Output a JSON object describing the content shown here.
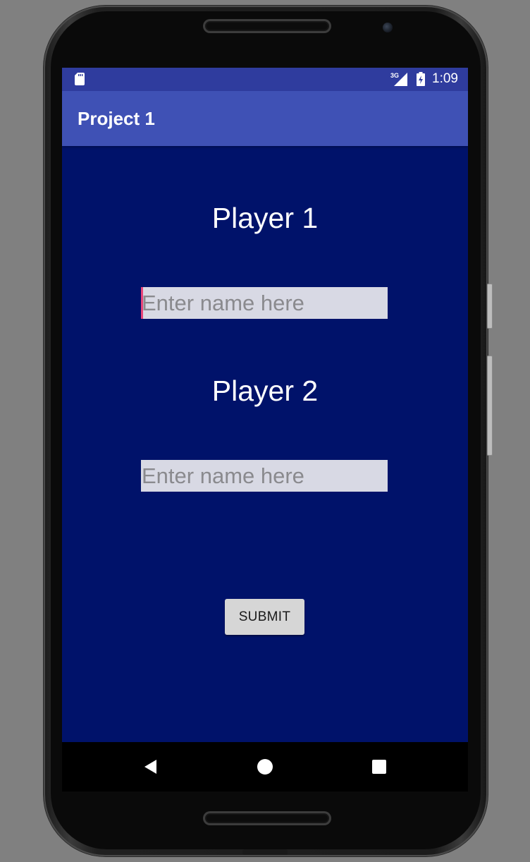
{
  "status_bar": {
    "time": "1:09",
    "network_label": "3G",
    "icons": [
      "sd-card-icon",
      "signal-3g-icon",
      "battery-charging-icon"
    ]
  },
  "app_bar": {
    "title": "Project 1"
  },
  "form": {
    "player1_label": "Player 1",
    "player1_input": {
      "value": "",
      "placeholder": "Enter name here"
    },
    "player2_label": "Player 2",
    "player2_input": {
      "value": "",
      "placeholder": "Enter name here"
    },
    "submit_label": "SUBMIT"
  },
  "nav_bar": {
    "icons": [
      "back-icon",
      "home-icon",
      "recents-icon"
    ]
  },
  "colors": {
    "screen_background": "#00126a",
    "app_bar": "#3f51b5",
    "status_bar": "#2f3c9e",
    "input_background": "#d8d9e4",
    "cursor_accent": "#e8457a",
    "button_background": "#d6d6d6"
  }
}
